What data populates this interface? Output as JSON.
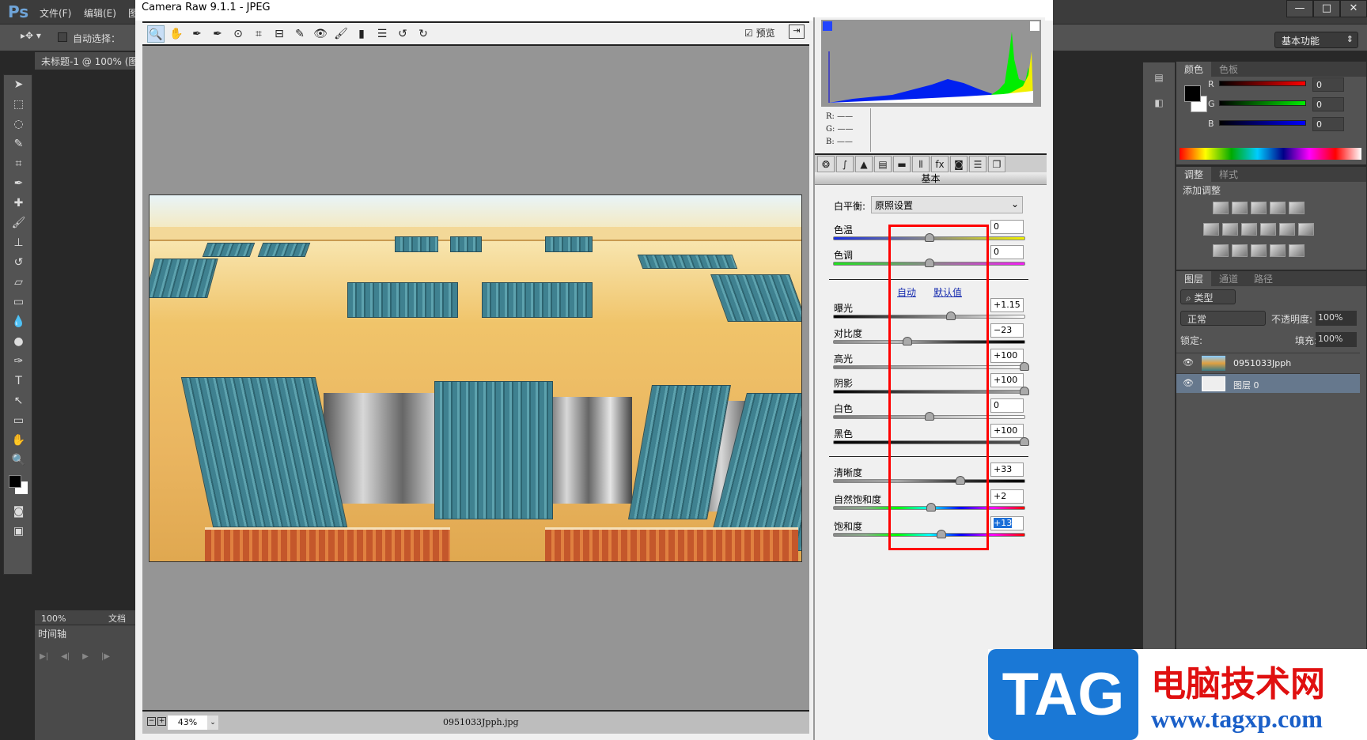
{
  "ps": {
    "logo": "Ps",
    "menus": [
      "文件(F)",
      "编辑(E)",
      "图"
    ],
    "auto_select": "自动选择：",
    "workspace": "基本功能",
    "window_controls": [
      "—",
      "□",
      "✕"
    ],
    "doc_tab": "未标题-1 @ 100% (图",
    "status_zoom": "100%",
    "status_doc": "文档",
    "timeline_tab": "时间轴",
    "timeline_controls": [
      "▶|",
      "◀|",
      "▶",
      "|▶"
    ]
  },
  "camera_raw": {
    "title": "Camera Raw 9.1.1  -  JPEG",
    "preview_label": "预览",
    "zoom": "43%",
    "filename": "0951033Jpph.jpg",
    "rgb": {
      "r": "R:  ——",
      "g": "G:  ——",
      "b": "B:  ——"
    },
    "panel_title": "基本",
    "white_balance": {
      "label": "白平衡:",
      "value": "原照设置"
    },
    "auto_link": "自动",
    "default_link": "默认值",
    "sliders": [
      {
        "label": "色温",
        "value": "0",
        "num": 0,
        "min": -100,
        "max": 100,
        "grad": "linear-gradient(90deg,#1a30e0,#888,#f0f000)"
      },
      {
        "label": "色调",
        "value": "0",
        "num": 0,
        "min": -100,
        "max": 100,
        "grad": "linear-gradient(90deg,#20e020,#888,#f020f0)"
      },
      {
        "label": "曝光",
        "value": "+1.15",
        "num": 1.15,
        "min": -5,
        "max": 5,
        "grad": "linear-gradient(90deg,#000,#fff)"
      },
      {
        "label": "对比度",
        "value": "−23",
        "num": -23,
        "min": -100,
        "max": 100,
        "grad": "linear-gradient(90deg,#888,#bbb,#333,#000)"
      },
      {
        "label": "高光",
        "value": "+100",
        "num": 100,
        "min": -100,
        "max": 100,
        "grad": "linear-gradient(90deg,#777,#fff)"
      },
      {
        "label": "阴影",
        "value": "+100",
        "num": 100,
        "min": -100,
        "max": 100,
        "grad": "linear-gradient(90deg,#000,#aaa)"
      },
      {
        "label": "白色",
        "value": "0",
        "num": 0,
        "min": -100,
        "max": 100,
        "grad": "linear-gradient(90deg,#777,#fff)"
      },
      {
        "label": "黑色",
        "value": "+100",
        "num": 100,
        "min": -100,
        "max": 100,
        "grad": "linear-gradient(90deg,#000,#555)"
      },
      {
        "label": "清晰度",
        "value": "+33",
        "num": 33,
        "min": -100,
        "max": 100,
        "grad": "linear-gradient(90deg,#888,#aaa,#333,#000)"
      },
      {
        "label": "自然饱和度",
        "value": "+2",
        "num": 2,
        "min": -100,
        "max": 100,
        "grad": "linear-gradient(90deg,#888,#8a8,#0f0,#0ff,#00f,#f0f,#f00)"
      },
      {
        "label": "饱和度",
        "value": "+13",
        "num": 13,
        "min": -100,
        "max": 100,
        "grad": "linear-gradient(90deg,#888,#8a8,#0f0,#0ff,#00f,#f0f,#f00)"
      }
    ]
  },
  "color_panel": {
    "tabs": [
      "颜色",
      "色板"
    ],
    "channels": [
      {
        "label": "R",
        "value": "0",
        "grad": "linear-gradient(90deg,#000,#f00)"
      },
      {
        "label": "G",
        "value": "0",
        "grad": "linear-gradient(90deg,#000,#0e0)"
      },
      {
        "label": "B",
        "value": "0",
        "grad": "linear-gradient(90deg,#000,#00f)"
      }
    ]
  },
  "adjust_panel": {
    "tabs": [
      "调整",
      "样式"
    ],
    "title": "添加调整"
  },
  "layers_panel": {
    "tabs": [
      "图层",
      "通道",
      "路径"
    ],
    "filter": "类型",
    "blend": "正常",
    "opacity_label": "不透明度:",
    "opacity": "100%",
    "lock_label": "锁定:",
    "fill_label": "填充:",
    "fill": "100%",
    "layers": [
      {
        "name": "0951033Jpph"
      },
      {
        "name": "图层 0"
      }
    ]
  },
  "watermark": {
    "tag": "TAG",
    "site_name": "电脑技术网",
    "url": "www.tagxp.com"
  }
}
